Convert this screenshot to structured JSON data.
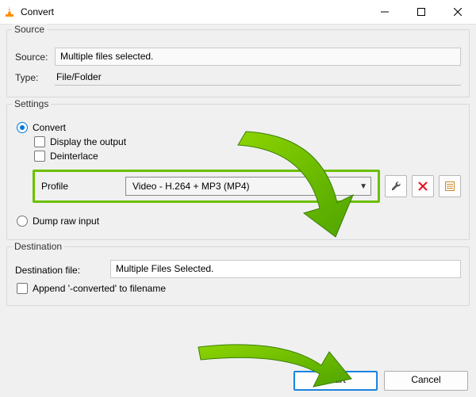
{
  "titlebar": {
    "title": "Convert"
  },
  "source": {
    "group_title": "Source",
    "label_source": "Source:",
    "value_source": "Multiple files selected.",
    "label_type": "Type:",
    "value_type": "File/Folder"
  },
  "settings": {
    "group_title": "Settings",
    "radio_convert": "Convert",
    "check_display": "Display the output",
    "check_deinterlace": "Deinterlace",
    "profile_label": "Profile",
    "profile_value": "Video - H.264 + MP3 (MP4)",
    "radio_dump": "Dump raw input"
  },
  "destination": {
    "group_title": "Destination",
    "label_destfile": "Destination file:",
    "value_destfile": "Multiple Files Selected.",
    "check_append": "Append '-converted' to filename"
  },
  "buttons": {
    "start": "Start",
    "cancel": "Cancel"
  }
}
